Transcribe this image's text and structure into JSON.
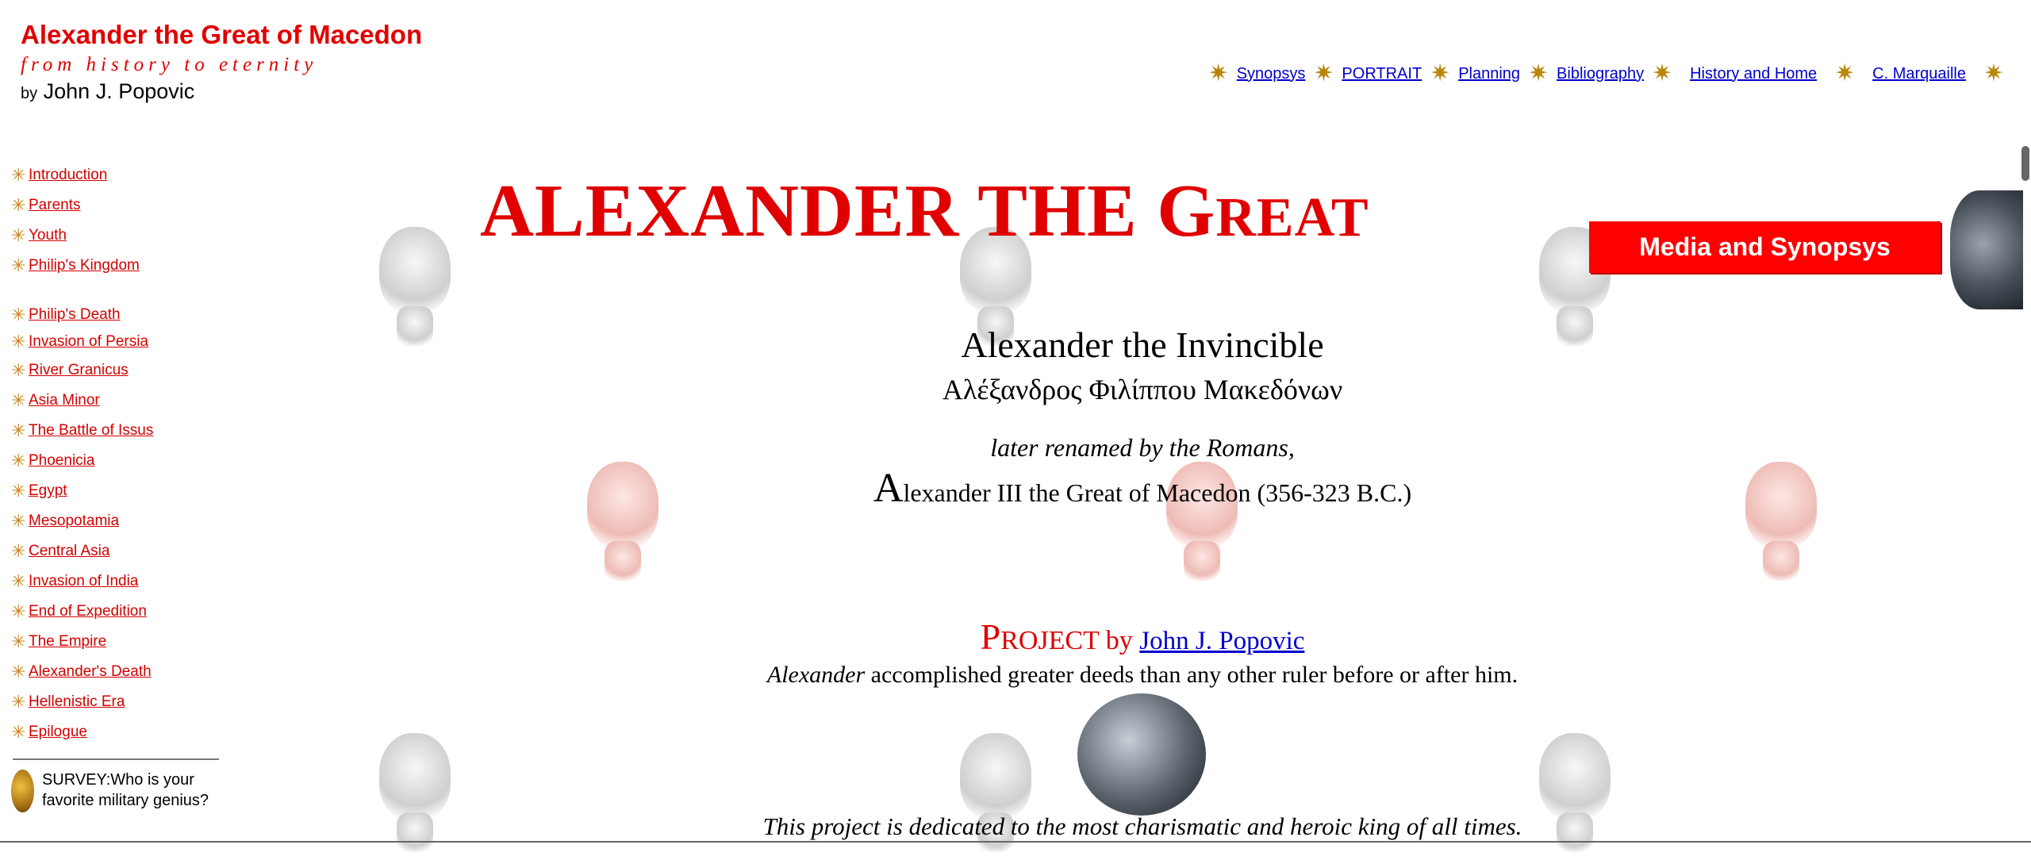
{
  "header": {
    "title": "Alexander the Great of Macedon",
    "tagline": "from history to eternity",
    "byline_prefix": "by",
    "byline_name": "John J. Popovic"
  },
  "topnav": [
    "Synopsys",
    "PORTRAIT",
    "Planning",
    "Bibliography",
    "History and Home",
    "C. Marquaille"
  ],
  "sidebar": {
    "group1": [
      "Introduction",
      "Parents",
      "Youth",
      "Philip's Kingdom"
    ],
    "group2": [
      "Philip's Death",
      "Invasion of Persia",
      "River Granicus",
      "Asia Minor",
      "The Battle of Issus",
      "Phoenicia",
      "Egypt",
      "Mesopotamia",
      "Central Asia",
      "Invasion of India",
      "End of Expedition",
      "The Empire",
      "Alexander's Death",
      "Hellenistic Era",
      "Epilogue"
    ],
    "survey": "SURVEY:Who is your favorite military genius?"
  },
  "main": {
    "title_main": "ALEXANDER THE G",
    "title_rest": "REAT",
    "media_button": "Media and Synopsys",
    "line1": "Alexander the Invincible",
    "line2": "Αλέξανδρος Φιλίππου Μακεδόνων",
    "line3": "later renamed by the Romans,",
    "line4_cap": "A",
    "line4_rest": "lexander III the Great of Macedon (356-323 B.C.)",
    "project_cap": "P",
    "project_rest": "ROJECT",
    "project_by": "by",
    "project_author": "John J. Popovic",
    "deeds_name": "Alexander",
    "deeds_rest": "accomplished greater deeds than any other ruler before or after him.",
    "dedication": "This project is dedicated to the most charismatic and heroic king of all times."
  },
  "colors": {
    "accent_red": "#e00000",
    "link_blue": "#0000cc",
    "star_gold": "#c8861b"
  },
  "icons": {
    "nav_star": "sun-star-icon",
    "survey": "gold-mask-icon"
  }
}
